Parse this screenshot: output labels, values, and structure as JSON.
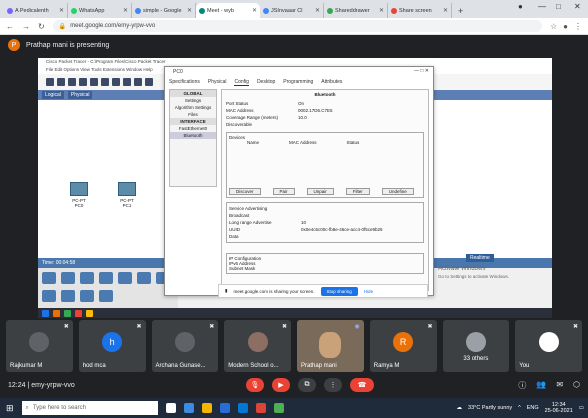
{
  "browser": {
    "tabs": [
      {
        "label": "A Pedicalenth",
        "color": "#7b61ff"
      },
      {
        "label": "WhatsApp",
        "color": "#25d366"
      },
      {
        "label": "simple - Google",
        "color": "#4285f4"
      },
      {
        "label": "Meet - wyb",
        "color": "#00897b",
        "active": true
      },
      {
        "label": "JSInvaaar Cl",
        "color": "#4285f4"
      },
      {
        "label": "Shareddrawer",
        "color": "#34a853"
      },
      {
        "label": "Share screen",
        "color": "#ea4335"
      }
    ],
    "url": "meet.google.com/emy-yrpw-vvo"
  },
  "meet": {
    "presenter_initial": "P",
    "presenting_text": "Prathap mani is presenting",
    "meeting_code": "12:24 | emy-yrpw-vvo",
    "participants": [
      {
        "name": "Rajkumar M",
        "initial": "",
        "color": "#5f6368"
      },
      {
        "name": "hod mca",
        "initial": "h",
        "color": "#1a73e8"
      },
      {
        "name": "Archana Gunase...",
        "initial": "",
        "color": "#5f6368"
      },
      {
        "name": "Modern School o...",
        "initial": "",
        "color": "#5f6368"
      },
      {
        "name": "Prathap mani",
        "initial": "",
        "color": "#5f6368"
      },
      {
        "name": "Ramya M",
        "initial": "R",
        "color": "#e8710a"
      },
      {
        "name": "33 others",
        "initial": "",
        "color": "#5f6368"
      },
      {
        "name": "You",
        "initial": "",
        "color": "#5f6368"
      }
    ]
  },
  "shared": {
    "pt_title": "Cisco Packet Tracer - C:\\Program Files\\Cisco Packet Tracer",
    "pt_menu": "File  Edit  Options  View  Tools  Extensions  Window  Help",
    "logical_tab": "Logical",
    "physical_tab": "Physical",
    "pc0_label": "PC-PT\nPC0",
    "pc1_label": "PC-PT\nPC1",
    "time_text": "Time: 00:04:58",
    "dialog": {
      "title": "PC0",
      "tabs": [
        "Specifications",
        "Physical",
        "Config",
        "Desktop",
        "Programming",
        "Attributes"
      ],
      "side_items": [
        "GLOBAL",
        "Settings",
        "Algorithm Settings",
        "Files",
        "INTERFACE",
        "FastEthernet0",
        "Bluetooth"
      ],
      "section_header": "Bluetooth",
      "fields": [
        {
          "k": "Port Status",
          "v": "On"
        },
        {
          "k": "MAC Address",
          "v": "0002.17D6.C7E5"
        },
        {
          "k": "Coverage Range (meters)",
          "v": "10.0"
        },
        {
          "k": "Discoverable",
          "v": ""
        }
      ],
      "devices_label": "Devices",
      "devices_cols": [
        "Name",
        "MAC Address",
        "Status"
      ],
      "device_buttons": [
        "Discover",
        "Pair",
        "Unpair",
        "Filter",
        "Undefine"
      ],
      "lower_fields": [
        {
          "k": "Service Advertising",
          "v": ""
        },
        {
          "k": "Broadcast",
          "v": ""
        },
        {
          "k": "Long range Advertise",
          "v": "10"
        },
        {
          "k": "UUID",
          "v": "0x0e4c6c00c-fb8e-46ce-acc4-0f5ce9b26"
        },
        {
          "k": "Data",
          "v": ""
        }
      ],
      "ipv6": [
        "IP Configuration",
        "IPv6 Address",
        "Subnet Mask"
      ]
    },
    "share_banner": "meet.google.com is sharing your screen.",
    "stop_sharing": "Stop sharing",
    "hide": "Hide",
    "realtime": "Realtime",
    "activate_title": "Activate Windows",
    "activate_sub": "Go to Settings to activate Windows."
  },
  "taskbar": {
    "search_placeholder": "Type here to search",
    "weather": "33°C  Partly sunny",
    "lang": "ENG",
    "time": "12:34",
    "date": "25-06-2021"
  }
}
